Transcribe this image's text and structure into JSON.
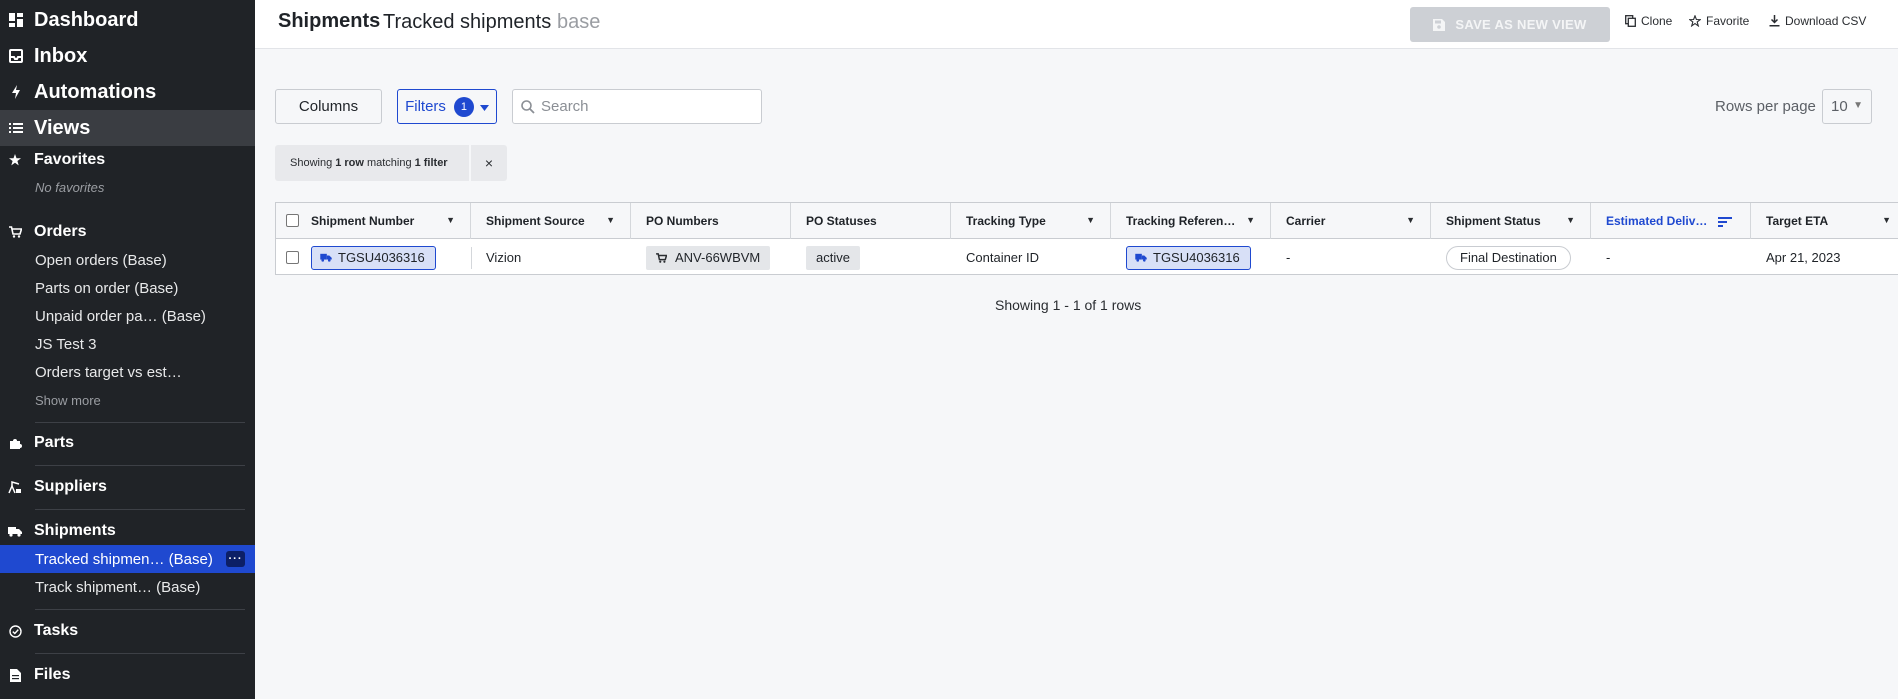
{
  "sidebar": {
    "main": [
      {
        "label": "Dashboard",
        "icon": "grid-icon"
      },
      {
        "label": "Inbox",
        "icon": "inbox-icon"
      },
      {
        "label": "Automations",
        "icon": "bolt-icon"
      },
      {
        "label": "Views",
        "icon": "list-icon"
      }
    ],
    "favorites": {
      "label": "Favorites",
      "empty": "No favorites"
    },
    "orders": {
      "label": "Orders",
      "items": [
        "Open orders (Base)",
        "Parts on order (Base)",
        "Unpaid order pa… (Base)",
        "JS Test 3",
        "Orders target vs est…"
      ],
      "show_more": "Show more"
    },
    "parts": "Parts",
    "suppliers": "Suppliers",
    "shipments": {
      "label": "Shipments",
      "items": [
        "Tracked shipmen… (Base)",
        "Track shipment… (Base)"
      ],
      "more": "···"
    },
    "tasks": "Tasks",
    "files": "Files"
  },
  "header": {
    "title": "Shipments",
    "view_name": "Tracked shipments",
    "view_tag": "base",
    "save_label": "SAVE AS NEW VIEW",
    "clone_label": "Clone",
    "favorite_label": "Favorite",
    "download_label": "Download CSV"
  },
  "toolbar": {
    "columns_label": "Columns",
    "filters_label": "Filters",
    "filters_count": "1",
    "search_placeholder": "Search",
    "rows_per_page_label": "Rows per page",
    "rows_per_page_value": "10"
  },
  "filter_summary": {
    "prefix": "Showing",
    "rows": "1 row",
    "mid": "matching",
    "filters": "1 filter",
    "close": "×"
  },
  "table": {
    "columns": [
      "Shipment Number",
      "Shipment Source",
      "PO Numbers",
      "PO Statuses",
      "Tracking Type",
      "Tracking Referen…",
      "Carrier",
      "Shipment Status",
      "Estimated Deliv…",
      "Target ETA"
    ],
    "row": {
      "shipment_number": "TGSU4036316",
      "shipment_source": "Vizion",
      "po_number": "ANV-66WBVM",
      "po_status": "active",
      "tracking_type": "Container ID",
      "tracking_reference": "TGSU4036316",
      "carrier": "-",
      "shipment_status": "Final Destination",
      "estimated_delivery": "-",
      "target_eta": "Apr 21, 2023"
    }
  },
  "pager": "Showing 1 - 1 of 1 rows",
  "colors": {
    "accent": "#1f49d0",
    "sidebar": "#202327"
  }
}
